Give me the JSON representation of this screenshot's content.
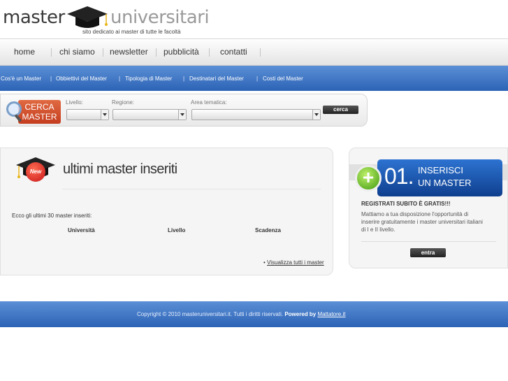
{
  "header": {
    "logo_master": "master",
    "logo_universitari": "universitari",
    "tagline": "sito dedicato ai master di tutte le facoltà"
  },
  "mainnav": {
    "items": [
      "home",
      "chi siamo",
      "newsletter",
      "pubblicità",
      "contatti"
    ]
  },
  "subnav": {
    "links": [
      "Cos'è un Master",
      "Obbiettivi del Master",
      "Tipologia di Master",
      "Destinatari del Master",
      "Costi del Master"
    ]
  },
  "search": {
    "badge_line1": "CERCA",
    "badge_line2": "MASTER",
    "livello_label": "Livello:",
    "regione_label": "Regione:",
    "area_label": "Area tematica:",
    "livello_value": "",
    "regione_value": "",
    "area_value": "",
    "button_label": "cerca"
  },
  "latest": {
    "badge": "New",
    "title": "ultimi master inseriti",
    "intro": "Ecco gli ultimi 30 master inseriti:",
    "columns": [
      "Università",
      "Livello",
      "Scadenza"
    ],
    "view_all_prefix": "•",
    "view_all_link": "Visualizza tutti i master"
  },
  "sidepanel": {
    "plus": "+",
    "number": "01.",
    "title_line1": "INSERISCI",
    "title_line2": "UN MASTER",
    "heading": "REGISTRATI SUBITO È GRATIS!!!",
    "description": "Mattiamo a tua disposizione l'opportunità di inserire gratuitamente i master universitari italiani di I e II livello.",
    "button_label": "entra"
  },
  "footer": {
    "copyright": "Copyright © 2010 masteruniversitari.it. Tutti i diritti riservati.",
    "powered_label": "Powered by",
    "powered_link": "Mattatore.it"
  },
  "colors": {
    "nav_blue": "#2c63b5",
    "cerca_red": "#c53d1e",
    "new_red": "#c8181a",
    "side_blue": "#0f3f8e",
    "plus_green": "#3f9a10"
  }
}
